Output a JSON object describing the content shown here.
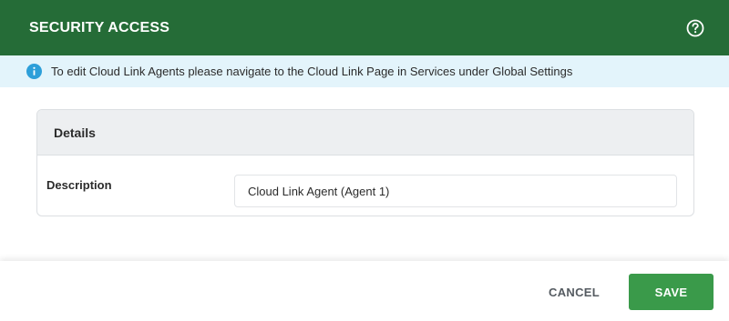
{
  "dialog": {
    "title": "SECURITY ACCESS",
    "help_icon": "help-circle-icon"
  },
  "info": {
    "icon": "info-icon",
    "message": "To edit Cloud Link Agents please navigate to the Cloud Link Page in Services under Global Settings"
  },
  "details": {
    "title": "Details",
    "description_label": "Description",
    "description_value": "Cloud Link Agent (Agent 1)"
  },
  "footer": {
    "cancel_label": "CANCEL",
    "save_label": "SAVE"
  },
  "colors": {
    "header_bg": "#256c37",
    "info_bg": "#e3f4fb",
    "info_icon": "#2d9fd9",
    "save_bg": "#3a9a4a"
  }
}
